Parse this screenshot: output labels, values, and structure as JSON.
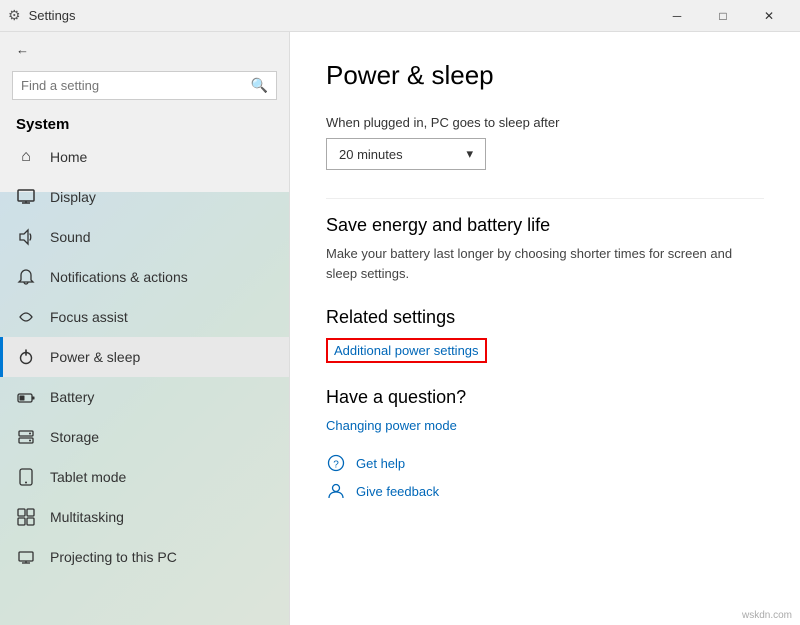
{
  "titlebar": {
    "app_name": "Settings",
    "back_label": "←",
    "min_label": "─",
    "max_label": "□",
    "close_label": "✕"
  },
  "sidebar": {
    "section_title": "System",
    "search_placeholder": "Find a setting",
    "back_text": "Settings",
    "items": [
      {
        "id": "home",
        "label": "Home",
        "icon": "⌂"
      },
      {
        "id": "display",
        "label": "Display",
        "icon": "🖥"
      },
      {
        "id": "sound",
        "label": "Sound",
        "icon": "🔊"
      },
      {
        "id": "notifications",
        "label": "Notifications & actions",
        "icon": "🔔"
      },
      {
        "id": "focus",
        "label": "Focus assist",
        "icon": "☽"
      },
      {
        "id": "power",
        "label": "Power & sleep",
        "icon": "⏻",
        "active": true
      },
      {
        "id": "battery",
        "label": "Battery",
        "icon": "🔋"
      },
      {
        "id": "storage",
        "label": "Storage",
        "icon": "💾"
      },
      {
        "id": "tablet",
        "label": "Tablet mode",
        "icon": "⊡"
      },
      {
        "id": "multitasking",
        "label": "Multitasking",
        "icon": "⊞"
      },
      {
        "id": "projecting",
        "label": "Projecting to this PC",
        "icon": "📺"
      }
    ]
  },
  "content": {
    "page_title": "Power & sleep",
    "sleep_label": "When plugged in, PC goes to sleep after",
    "sleep_dropdown_value": "20 minutes",
    "sleep_dropdown_arrow": "▾",
    "save_energy_heading": "Save energy and battery life",
    "save_energy_desc": "Make your battery last longer by choosing shorter times for screen and sleep settings.",
    "related_settings_heading": "Related settings",
    "additional_power_link": "Additional power settings",
    "question_heading": "Have a question?",
    "changing_power_link": "Changing power mode",
    "get_help_label": "Get help",
    "give_feedback_label": "Give feedback",
    "get_help_icon": "❓",
    "give_feedback_icon": "👤",
    "watermark": "wskdn.com"
  }
}
